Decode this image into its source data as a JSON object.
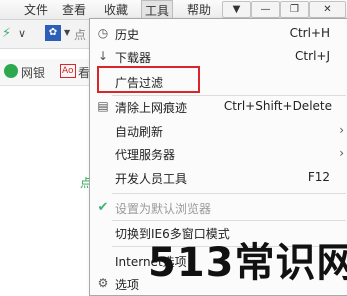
{
  "menubar": {
    "items": [
      "文件",
      "查看",
      "收藏",
      "工具",
      "帮助"
    ],
    "active": "工具"
  },
  "toolbar": {
    "partial_text": "点",
    "wangyin": "网银",
    "ao_badge": "Ao",
    "ao_text": "看"
  },
  "content": {
    "partial_text": "点"
  },
  "tools_menu": {
    "items": [
      {
        "icon": "clock-icon",
        "label": "历史",
        "shortcut": "Ctrl+H"
      },
      {
        "icon": "download-arrow-icon",
        "label": "下载器",
        "shortcut": "Ctrl+J"
      },
      {
        "icon": "",
        "label": "广告过滤",
        "shortcut": ""
      },
      {
        "icon": "trash-icon",
        "label": "清除上网痕迹",
        "shortcut": "Ctrl+Shift+Delete"
      },
      {
        "icon": "",
        "label": "自动刷新",
        "shortcut": "",
        "submenu": true
      },
      {
        "icon": "",
        "label": "代理服务器",
        "shortcut": "",
        "submenu": true
      },
      {
        "icon": "",
        "label": "开发人员工具",
        "shortcut": "F12"
      },
      {
        "icon": "check-icon",
        "label": "设置为默认浏览器",
        "shortcut": "",
        "disabled": true
      },
      {
        "icon": "",
        "label": "切换到IE6多窗口模式",
        "shortcut": ""
      },
      {
        "icon": "",
        "label": "Internet选项",
        "shortcut": ""
      },
      {
        "icon": "gear-icon",
        "label": "选项",
        "shortcut": ""
      }
    ]
  },
  "watermark": "513常识网",
  "colors": {
    "highlight": "#d9262b",
    "check": "#3cb371"
  }
}
